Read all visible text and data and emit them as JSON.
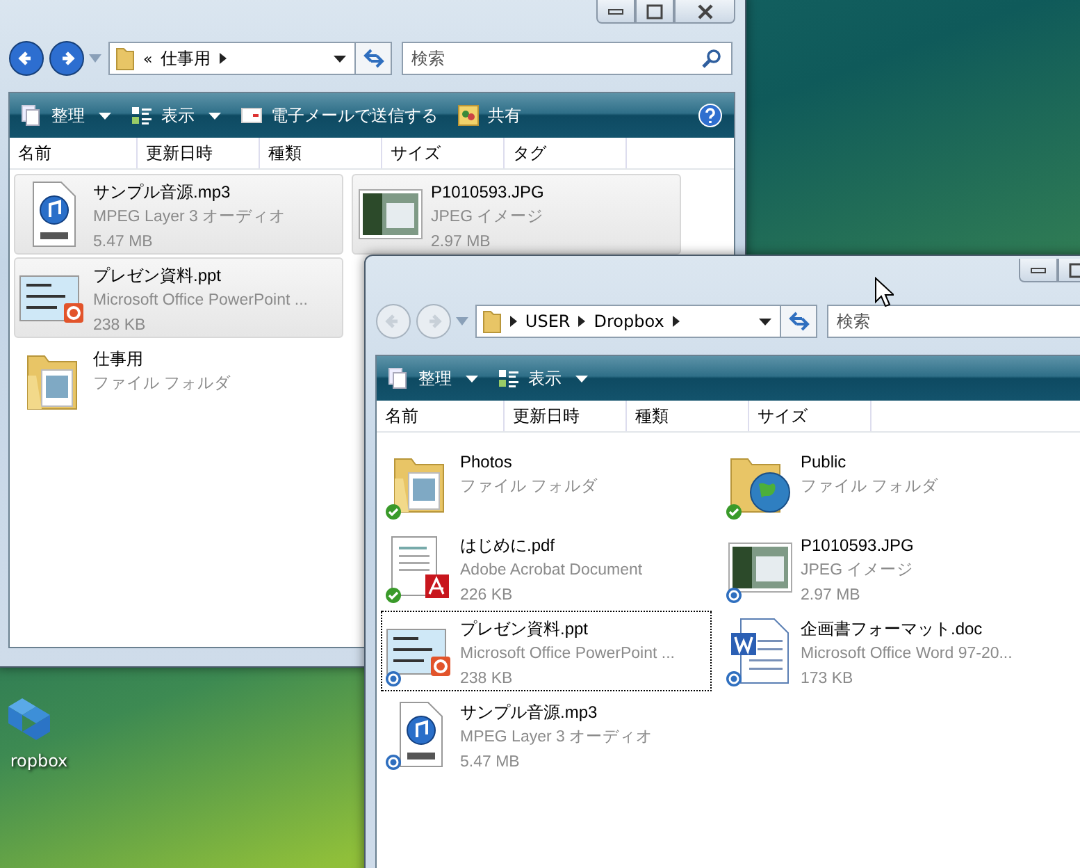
{
  "desktop": {
    "icons": [
      {
        "label": "ropbox"
      }
    ]
  },
  "windows": [
    {
      "nav": {
        "back_enabled": true,
        "forward_enabled": true
      },
      "address": {
        "overflow_mark": "«",
        "segments": [
          "仕事用"
        ]
      },
      "search": {
        "placeholder": "検索"
      },
      "toolbar": [
        {
          "label": "整理",
          "kind": "organize",
          "dropdown": true
        },
        {
          "label": "表示",
          "kind": "views",
          "dropdown": true
        },
        {
          "label": "電子メールで送信する",
          "kind": "email",
          "dropdown": false
        },
        {
          "label": "共有",
          "kind": "share",
          "dropdown": false
        }
      ],
      "help": true,
      "columns": [
        "名前",
        "更新日時",
        "種類",
        "サイズ",
        "タグ"
      ],
      "items": [
        {
          "name": "サンプル音源.mp3",
          "type": "MPEG Layer 3 オーディオ",
          "size": "5.47 MB",
          "kind": "mp3",
          "selected": true,
          "focused": false
        },
        {
          "name": "プレゼン資料.ppt",
          "type": "Microsoft Office PowerPoint ...",
          "size": "238 KB",
          "kind": "ppt",
          "selected": true,
          "focused": false
        },
        {
          "name": "仕事用",
          "type": "ファイル フォルダ",
          "kind": "folder",
          "selected": false,
          "focused": false
        },
        {
          "name": "P1010593.JPG",
          "type": "JPEG イメージ",
          "size": "2.97 MB",
          "kind": "jpg",
          "selected": true,
          "focused": false
        }
      ]
    },
    {
      "nav": {
        "back_enabled": false,
        "forward_enabled": false
      },
      "address": {
        "segments": [
          "USER",
          "Dropbox"
        ]
      },
      "search": {
        "placeholder": "検索"
      },
      "toolbar": [
        {
          "label": "整理",
          "kind": "organize",
          "dropdown": true
        },
        {
          "label": "表示",
          "kind": "views",
          "dropdown": true
        }
      ],
      "help": false,
      "columns": [
        "名前",
        "更新日時",
        "種類",
        "サイズ"
      ],
      "items": [
        {
          "name": "Photos",
          "type": "ファイル フォルダ",
          "kind": "folder",
          "selected": false,
          "focused": false,
          "synced": true
        },
        {
          "name": "Public",
          "type": "ファイル フォルダ",
          "kind": "public-folder",
          "selected": false,
          "focused": false,
          "synced": true
        },
        {
          "name": "はじめに.pdf",
          "type": "Adobe Acrobat Document",
          "size": "226 KB",
          "kind": "pdf",
          "selected": false,
          "focused": false,
          "synced": true
        },
        {
          "name": "P1010593.JPG",
          "type": "JPEG イメージ",
          "size": "2.97 MB",
          "kind": "jpg",
          "selected": false,
          "focused": false,
          "synced": false
        },
        {
          "name": "プレゼン資料.ppt",
          "type": "Microsoft Office PowerPoint ...",
          "size": "238 KB",
          "kind": "ppt",
          "selected": false,
          "focused": true,
          "synced": false
        },
        {
          "name": "企画書フォーマット.doc",
          "type": "Microsoft Office Word 97-20...",
          "size": "173 KB",
          "kind": "doc",
          "selected": false,
          "focused": false,
          "synced": false
        },
        {
          "name": "サンプル音源.mp3",
          "type": "MPEG Layer 3 オーディオ",
          "size": "5.47 MB",
          "kind": "mp3",
          "selected": false,
          "focused": false,
          "synced": false
        }
      ]
    }
  ]
}
